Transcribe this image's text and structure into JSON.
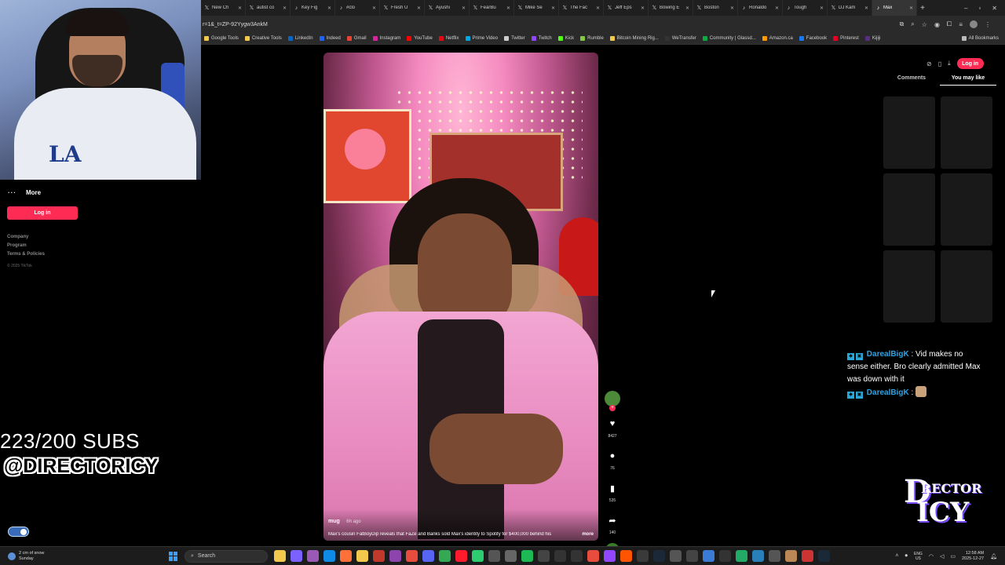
{
  "browser": {
    "tabs": [
      {
        "label": "New Ch",
        "icon": "x-icon"
      },
      {
        "label": "autist co",
        "icon": "x-icon"
      },
      {
        "label": "Key Fig",
        "icon": "tiktok-icon"
      },
      {
        "label": "#clo",
        "icon": "tiktok-icon"
      },
      {
        "label": "Fresh U",
        "icon": "x-icon"
      },
      {
        "label": "Ayushi",
        "icon": "x-icon"
      },
      {
        "label": "FearBu",
        "icon": "x-icon"
      },
      {
        "label": "Mike Se",
        "icon": "x-icon"
      },
      {
        "label": "The Fac",
        "icon": "x-icon"
      },
      {
        "label": "Jeff Eps",
        "icon": "x-icon"
      },
      {
        "label": "Bowing E",
        "icon": "x-icon"
      },
      {
        "label": "Boston",
        "icon": "x-icon"
      },
      {
        "label": "Ronaldo",
        "icon": "tiktok-icon"
      },
      {
        "label": "Tough",
        "icon": "tiktok-icon"
      },
      {
        "label": "DJ Kam",
        "icon": "x-icon"
      },
      {
        "label": "Max",
        "icon": "tiktok-icon"
      }
    ],
    "url": "r=1&_t=ZP-92Yygw3AnkM",
    "bookmarks": [
      {
        "label": "Google Tools",
        "color": "#f2c94c"
      },
      {
        "label": "Creative Tools",
        "color": "#f2c94c"
      },
      {
        "label": "LinkedIn",
        "color": "#0a66c2"
      },
      {
        "label": "Indeed",
        "color": "#2164f3"
      },
      {
        "label": "Gmail",
        "color": "#ea4335"
      },
      {
        "label": "Instagram",
        "color": "#d6249f"
      },
      {
        "label": "YouTube",
        "color": "#ff0000"
      },
      {
        "label": "Netflix",
        "color": "#e50914"
      },
      {
        "label": "Prime Video",
        "color": "#00a8e1"
      },
      {
        "label": "Twitter",
        "color": "#cccccc"
      },
      {
        "label": "Twitch",
        "color": "#9146ff"
      },
      {
        "label": "Kick",
        "color": "#53fc18"
      },
      {
        "label": "Rumble",
        "color": "#85c742"
      },
      {
        "label": "Bitcoin Mining Rig...",
        "color": "#f2c94c"
      },
      {
        "label": "WeTransfer",
        "color": "#333333"
      },
      {
        "label": "Community | Glassd...",
        "color": "#0caa41"
      },
      {
        "label": "Amazon.ca",
        "color": "#ff9900"
      },
      {
        "label": "Facebook",
        "color": "#1877f2"
      },
      {
        "label": "Pinterest",
        "color": "#e60023"
      },
      {
        "label": "Kijiji",
        "color": "#5a2d82"
      }
    ],
    "all_bookmarks": "All Bookmarks"
  },
  "sidebar": {
    "more_label": "More",
    "login_label": "Log in",
    "footer_links": [
      "Company",
      "Program",
      "Terms & Policies"
    ],
    "copyright": "© 2025 TikTok"
  },
  "overlay": {
    "subs_text": "223/200 SUBS",
    "handle_text": "@DIRECTORICY"
  },
  "video": {
    "author": "mug",
    "time": "6h ago",
    "description": "Max's cousin FatBoyDip reveals that FaZe and Banks sold Max's identity to Spotify for $400,000 behind his",
    "more_label": "more",
    "likes": "8427",
    "comments": "76",
    "saves": "535",
    "shares": "140"
  },
  "right_panel": {
    "login_label": "Log in",
    "tabs": [
      "Comments",
      "You may like"
    ],
    "active_tab": "You may like"
  },
  "chat": [
    {
      "user": "DarealBigK",
      "message": "Vid makes no sense either. Bro clearly admitted Max was down with it"
    },
    {
      "user": "DarealBigK",
      "message": ""
    }
  ],
  "logo": {
    "d": "D",
    "rector": "RECTOR",
    "icy": "ICY"
  },
  "taskbar": {
    "weather_line1": "2 cm of snow",
    "weather_line2": "Sunday",
    "search_placeholder": "Search",
    "lang_line1": "ENG",
    "lang_line2": "US",
    "time": "12:58 AM",
    "date": "2025-12-27"
  },
  "colors": {
    "accent": "#fe2c55",
    "chat_name": "#2aa4e8"
  }
}
